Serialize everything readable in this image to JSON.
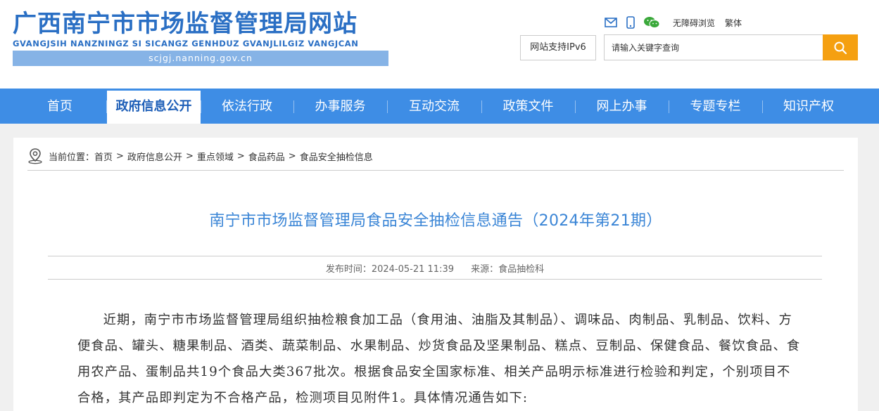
{
  "site": {
    "title": "广西南宁市市场监督管理局网站",
    "pinyin": "GVANGJSIH NANZNINGZ SI SICANGZ GENHDUZ GVANJLILGIZ VANGJCAN",
    "domain": "scjgj.nanning.gov.cn"
  },
  "toolbar": {
    "mail_icon": "mail-icon",
    "mobile_icon": "mobile-icon",
    "wechat_icon": "wechat-icon",
    "accessibility": "无障碍浏览",
    "traditional": "繁体"
  },
  "ipv6": "网站支持IPv6",
  "search": {
    "placeholder": "请输入关键字查询",
    "button_color": "#f5a011"
  },
  "nav": {
    "items": [
      {
        "label": "首页"
      },
      {
        "label": "政府信息公开"
      },
      {
        "label": "依法行政"
      },
      {
        "label": "办事服务"
      },
      {
        "label": "互动交流"
      },
      {
        "label": "政策文件"
      },
      {
        "label": "网上办事"
      },
      {
        "label": "专题专栏"
      },
      {
        "label": "知识产权"
      }
    ],
    "active_index": 1,
    "color": "#3e8de5"
  },
  "breadcrumb": {
    "prefix": "当前位置：",
    "items": [
      "首页",
      "政府信息公开",
      "重点领域",
      "食品药品",
      "食品安全抽检信息"
    ],
    "separator": ">"
  },
  "article": {
    "title": "南宁市市场监督管理局食品安全抽检信息通告（2024年第21期）",
    "published": "发布时间：2024-05-21 11:39",
    "source": "来源：食品抽检科",
    "body": "近期，南宁市市场监督管理局组织抽检粮食加工品（食用油、油脂及其制品）、调味品、肉制品、乳制品、饮料、方便食品、罐头、糖果制品、酒类、蔬菜制品、水果制品、炒货食品及坚果制品、糕点、豆制品、保健食品、餐饮食品、食用农产品、蛋制品共19个食品大类367批次。根据食品安全国家标准、相关产品明示标准进行检验和判定，个别项目不合格，其产品即判定为不合格产品，检测项目见附件1。具体情况通告如下:"
  }
}
